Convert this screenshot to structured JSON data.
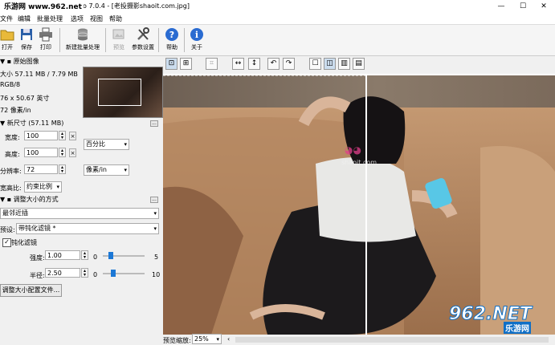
{
  "window": {
    "title_suffix": "o 7.0.4 - [老投摄影shaoit.com.jpg]",
    "watermark": "乐游网 www.962.net",
    "controls": [
      "—",
      "☐",
      "✕"
    ]
  },
  "menu": [
    "文件",
    "编辑",
    "批量处理",
    "选项",
    "视图",
    "帮助"
  ],
  "toolbar": {
    "open": "打开",
    "save": "保存",
    "print": "打印",
    "batch": "新建批量处理",
    "preview": "预览",
    "params": "参数设置",
    "help": "帮助",
    "about": "关于"
  },
  "original": {
    "header": "原始图像",
    "size": "大小 57.11 MB / 7.79 MB",
    "mode": "RGB/8",
    "dims": "76 x 50.67 英寸",
    "res": "72 像素/in"
  },
  "newsize": {
    "header": "新尺寸 (57.11 MB)",
    "width_label": "宽度:",
    "width_value": "100",
    "height_label": "高度:",
    "height_value": "100",
    "unit": "百分比",
    "res_label": "分辨率:",
    "res_value": "72",
    "res_unit": "像素/in",
    "aspect_label": "宽高比:",
    "aspect_value": "约束比例"
  },
  "method": {
    "header": "调整大小的方式",
    "algo": "最邻近插",
    "preset_label": "预设:",
    "preset_value": "带钝化滤镜 *",
    "sharpen_label": "钝化滤镜",
    "amount_label": "强度:",
    "amount_value": "1.00",
    "amount_min": "0",
    "amount_max": "5",
    "amount_pct": 0.2,
    "radius_label": "半径:",
    "radius_value": "2.50",
    "radius_min": "0",
    "radius_max": "10",
    "radius_pct": 0.25,
    "config_button": "调整大小配置文件..."
  },
  "status": {
    "zoom_label": "预览缩放:",
    "zoom_value": "25%"
  },
  "photo_watermark": {
    "big": "962.NET",
    "small": "乐游网",
    "site": "shaoit.com"
  },
  "colors": {
    "accent": "#1c78d6",
    "watermark_blue": "#0f6fc6"
  }
}
